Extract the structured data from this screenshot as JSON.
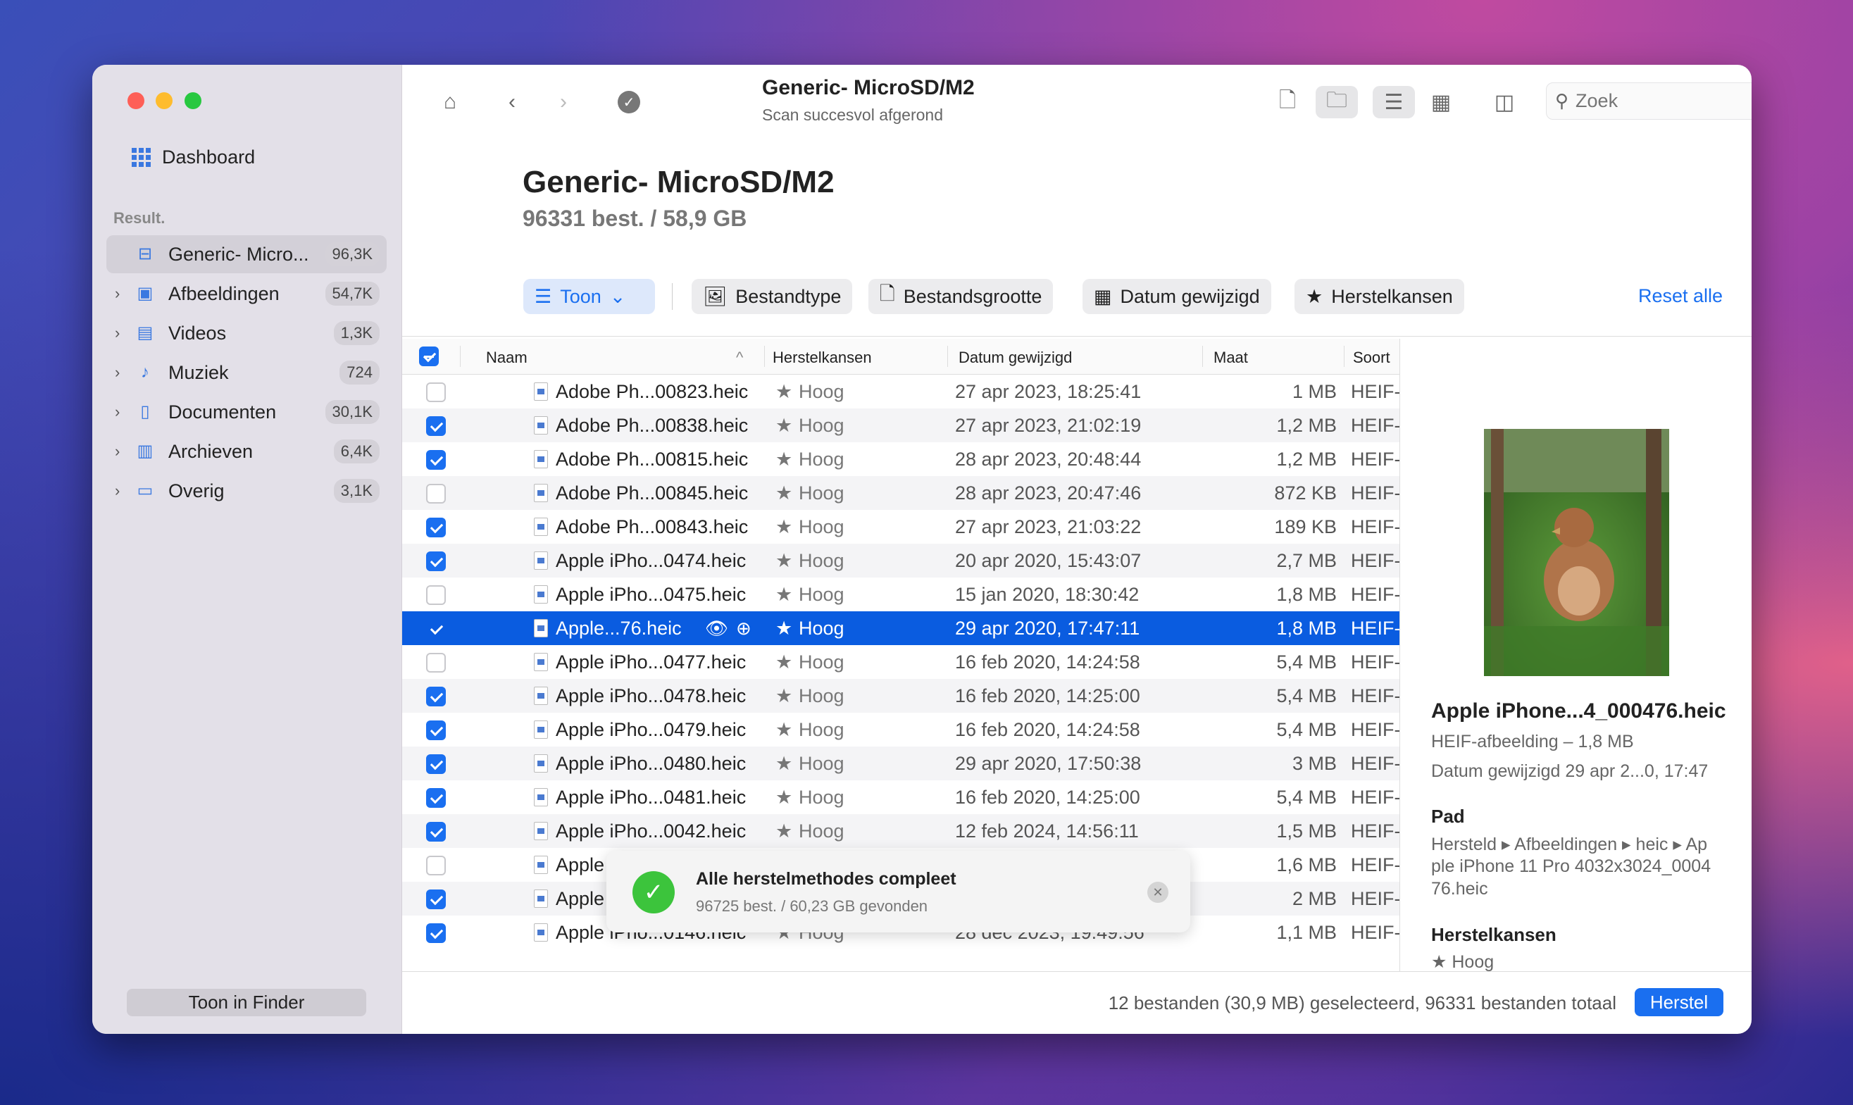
{
  "sidebar": {
    "dashboard": "Dashboard",
    "section": "Result.",
    "items": [
      {
        "label": "Generic- Micro...",
        "count": "96,3K",
        "icon": "drive-icon",
        "selected": true
      },
      {
        "label": "Afbeeldingen",
        "count": "54,7K",
        "icon": "image-icon"
      },
      {
        "label": "Videos",
        "count": "1,3K",
        "icon": "film-icon"
      },
      {
        "label": "Muziek",
        "count": "724",
        "icon": "music-note-icon"
      },
      {
        "label": "Documenten",
        "count": "30,1K",
        "icon": "document-icon"
      },
      {
        "label": "Archieven",
        "count": "6,4K",
        "icon": "archive-icon"
      },
      {
        "label": "Overig",
        "count": "3,1K",
        "icon": "other-file-icon"
      }
    ],
    "finder_button": "Toon in Finder"
  },
  "toolbar": {
    "title": "Generic- MicroSD/M2",
    "subtitle": "Scan succesvol afgerond",
    "search_placeholder": "Zoek"
  },
  "header": {
    "title": "Generic- MicroSD/M2",
    "subtitle": "96331 best. / 58,9 GB"
  },
  "filters": {
    "toon": "Toon",
    "type": "Bestandtype",
    "size": "Bestandsgrootte",
    "date": "Datum gewijzigd",
    "chance": "Herstelkansen",
    "reset": "Reset alle"
  },
  "table": {
    "columns": [
      "Naam",
      "Herstelkansen",
      "Datum gewijzigd",
      "Maat",
      "Soort"
    ],
    "rows": [
      {
        "name": "Adobe Ph...00823.heic",
        "kans": "Hoog",
        "date": "27 apr 2023, 18:25:41",
        "size": "1 MB",
        "type": "HEIF-",
        "checked": false
      },
      {
        "name": "Adobe Ph...00838.heic",
        "kans": "Hoog",
        "date": "27 apr 2023, 21:02:19",
        "size": "1,2 MB",
        "type": "HEIF-",
        "checked": true
      },
      {
        "name": "Adobe Ph...00815.heic",
        "kans": "Hoog",
        "date": "28 apr 2023, 20:48:44",
        "size": "1,2 MB",
        "type": "HEIF-",
        "checked": true
      },
      {
        "name": "Adobe Ph...00845.heic",
        "kans": "Hoog",
        "date": "28 apr 2023, 20:47:46",
        "size": "872 KB",
        "type": "HEIF-",
        "checked": false
      },
      {
        "name": "Adobe Ph...00843.heic",
        "kans": "Hoog",
        "date": "27 apr 2023, 21:03:22",
        "size": "189 KB",
        "type": "HEIF-",
        "checked": true
      },
      {
        "name": "Apple iPho...0474.heic",
        "kans": "Hoog",
        "date": "20 apr 2020, 15:43:07",
        "size": "2,7 MB",
        "type": "HEIF-",
        "checked": true
      },
      {
        "name": "Apple iPho...0475.heic",
        "kans": "Hoog",
        "date": "15 jan 2020, 18:30:42",
        "size": "1,8 MB",
        "type": "HEIF-",
        "checked": false
      },
      {
        "name": "Apple...76.heic",
        "kans": "Hoog",
        "date": "29 apr 2020, 17:47:11",
        "size": "1,8 MB",
        "type": "HEIF-",
        "checked": true,
        "selected": true
      },
      {
        "name": "Apple iPho...0477.heic",
        "kans": "Hoog",
        "date": "16 feb 2020, 14:24:58",
        "size": "5,4 MB",
        "type": "HEIF-",
        "checked": false
      },
      {
        "name": "Apple iPho...0478.heic",
        "kans": "Hoog",
        "date": "16 feb 2020, 14:25:00",
        "size": "5,4 MB",
        "type": "HEIF-",
        "checked": true
      },
      {
        "name": "Apple iPho...0479.heic",
        "kans": "Hoog",
        "date": "16 feb 2020, 14:24:58",
        "size": "5,4 MB",
        "type": "HEIF-",
        "checked": true
      },
      {
        "name": "Apple iPho...0480.heic",
        "kans": "Hoog",
        "date": "29 apr 2020, 17:50:38",
        "size": "3 MB",
        "type": "HEIF-",
        "checked": true
      },
      {
        "name": "Apple iPho...0481.heic",
        "kans": "Hoog",
        "date": "16 feb 2020, 14:25:00",
        "size": "5,4 MB",
        "type": "HEIF-",
        "checked": true
      },
      {
        "name": "Apple iPho...0042.heic",
        "kans": "Hoog",
        "date": "12 feb 2024, 14:56:11",
        "size": "1,5 MB",
        "type": "HEIF-",
        "checked": true
      },
      {
        "name": "Apple",
        "size": "1,6 MB",
        "type": "HEIF-",
        "checked": false
      },
      {
        "name": "Apple",
        "size": "2 MB",
        "type": "HEIF-",
        "checked": true
      },
      {
        "name": "Apple iPho...0146.heic",
        "kans": "Hoog",
        "date": "28 dec 2023, 19:49:56",
        "size": "1,1 MB",
        "type": "HEIF-",
        "checked": true
      }
    ]
  },
  "toast": {
    "title": "Alle herstelmethodes compleet",
    "subtitle": "96725 best. / 60,23 GB gevonden"
  },
  "preview": {
    "filename": "Apple iPhone...4_000476.heic",
    "kind": "HEIF-afbeelding – 1,8 MB",
    "date": "Datum gewijzigd 29 apr 2...0, 17:47",
    "path_label": "Pad",
    "path_lines": [
      "Hersteld ▸ Afbeeldingen ▸ heic ▸ Ap",
      "ple iPhone 11 Pro 4032x3024_0004",
      "76.heic"
    ],
    "chance_label": "Herstelkansen",
    "chance": "Hoog"
  },
  "footer": {
    "status": "12 bestanden (30,9 MB) geselecteerd, 96331 bestanden totaal",
    "recover": "Herstel"
  },
  "colors": {
    "accent": "#1a6ff0",
    "success": "#3cc43c"
  }
}
